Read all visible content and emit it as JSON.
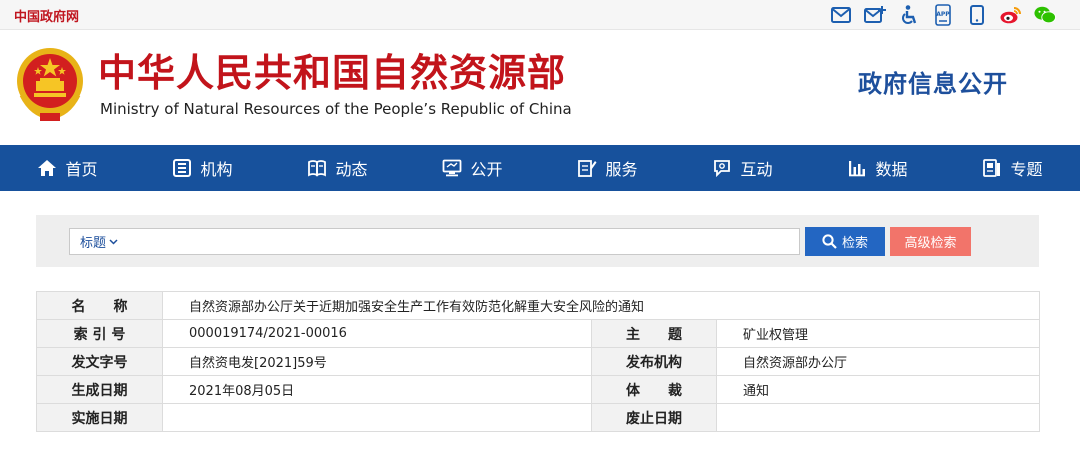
{
  "topbar": {
    "site_link": "中国政府网",
    "icons": [
      "mail-icon",
      "mail-plus-icon",
      "accessibility-icon",
      "app-icon",
      "mobile-icon",
      "weibo-icon",
      "wechat-icon"
    ],
    "app_text": "APP"
  },
  "header": {
    "org_name_cn": "中华人民共和国自然资源部",
    "org_name_en": "Ministry of Natural Resources of the People’s Republic of China",
    "section_title": "政府信息公开"
  },
  "nav": {
    "items": [
      {
        "label": "首页",
        "icon": "home-icon"
      },
      {
        "label": "机构",
        "icon": "org-icon"
      },
      {
        "label": "动态",
        "icon": "book-icon"
      },
      {
        "label": "公开",
        "icon": "monitor-icon"
      },
      {
        "label": "服务",
        "icon": "edit-doc-icon"
      },
      {
        "label": "互动",
        "icon": "chat-icon"
      },
      {
        "label": "数据",
        "icon": "bar-chart-icon"
      },
      {
        "label": "专题",
        "icon": "topic-icon"
      }
    ]
  },
  "search": {
    "field_select": "标题",
    "input_value": "",
    "input_placeholder": "",
    "search_label": "检索",
    "advanced_label": "高级检索"
  },
  "info": {
    "name_label": "名　　称",
    "name_value": "自然资源部办公厅关于近期加强安全生产工作有效防范化解重大安全风险的通知",
    "index_label": "索 引 号",
    "index_value": "000019174/2021-00016",
    "subject_label": "主　　题",
    "subject_value": "矿业权管理",
    "doc_no_label": "发文字号",
    "doc_no_value": "自然资电发[2021]59号",
    "issuer_label": "发布机构",
    "issuer_value": "自然资源部办公厅",
    "created_label": "生成日期",
    "created_value": "2021年08月05日",
    "genre_label": "体　　裁",
    "genre_value": "通知",
    "effective_label": "实施日期",
    "effective_value": "",
    "expiry_label": "废止日期",
    "expiry_value": ""
  },
  "colors": {
    "brand_red": "#c2141b",
    "nav_blue": "#17519c",
    "title_blue": "#1d4f9c",
    "search_blue": "#2366c2",
    "advanced_salmon": "#f2746a"
  }
}
